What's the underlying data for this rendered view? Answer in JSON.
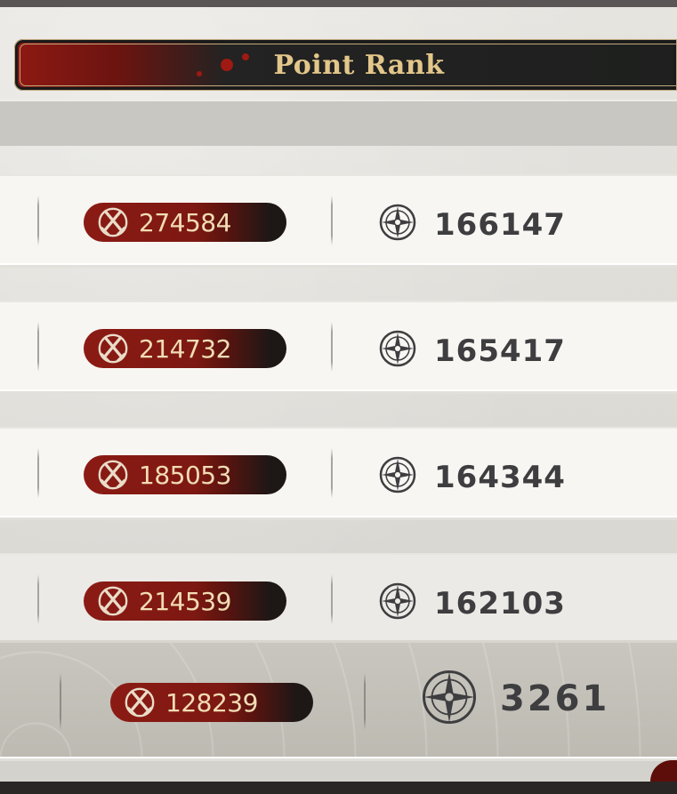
{
  "header": {
    "title": "Point Rank"
  },
  "rows": [
    {
      "kills": "274584",
      "points": "166147"
    },
    {
      "kills": "214732",
      "points": "165417"
    },
    {
      "kills": "185053",
      "points": "164344"
    },
    {
      "kills": "214539",
      "points": "162103"
    }
  ],
  "self_row": {
    "kills": "128239",
    "points": "3261"
  },
  "icons": {
    "kills_icon": "crossed-swords-icon",
    "points_icon": "compass-icon"
  },
  "colors": {
    "accent_red": "#8b1b14",
    "title_gold": "#e3c68a",
    "score_text": "#3e3e40",
    "pill_text": "#f2dcb4"
  }
}
